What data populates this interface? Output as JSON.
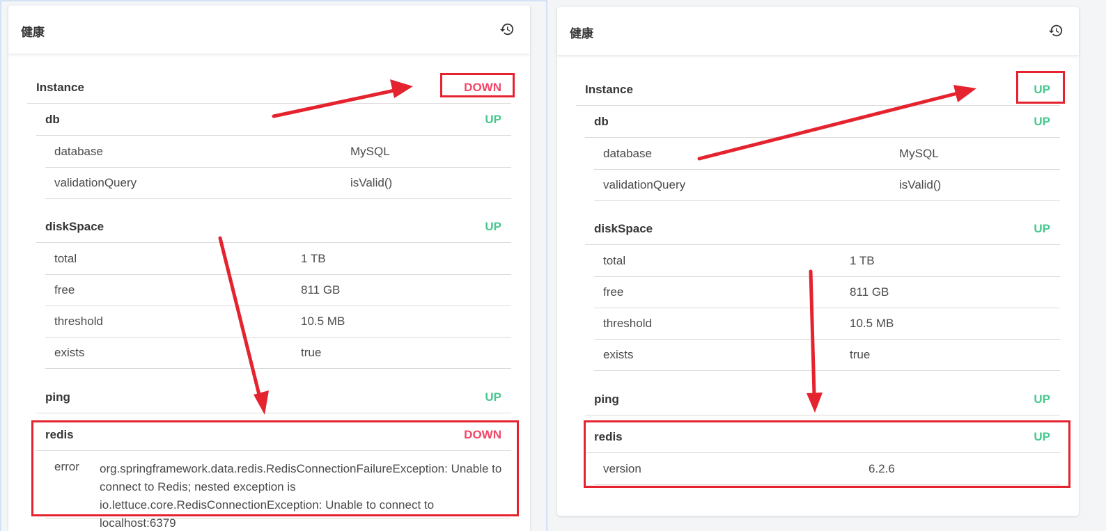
{
  "left": {
    "title": "健康",
    "instance": {
      "label": "Instance",
      "status": "DOWN"
    },
    "db": {
      "label": "db",
      "status": "UP",
      "details": [
        {
          "key": "database",
          "value": "MySQL"
        },
        {
          "key": "validationQuery",
          "value": "isValid()"
        }
      ]
    },
    "diskSpace": {
      "label": "diskSpace",
      "status": "UP",
      "details": [
        {
          "key": "total",
          "value": "1 TB"
        },
        {
          "key": "free",
          "value": "811 GB"
        },
        {
          "key": "threshold",
          "value": "10.5 MB"
        },
        {
          "key": "exists",
          "value": "true"
        }
      ]
    },
    "ping": {
      "label": "ping",
      "status": "UP"
    },
    "redis": {
      "label": "redis",
      "status": "DOWN",
      "error_key": "error",
      "error_value": "org.springframework.data.redis.RedisConnectionFailureException: Unable to connect to Redis; nested exception is io.lettuce.core.RedisConnectionException: Unable to connect to localhost:6379"
    }
  },
  "right": {
    "title": "健康",
    "instance": {
      "label": "Instance",
      "status": "UP"
    },
    "db": {
      "label": "db",
      "status": "UP",
      "details": [
        {
          "key": "database",
          "value": "MySQL"
        },
        {
          "key": "validationQuery",
          "value": "isValid()"
        }
      ]
    },
    "diskSpace": {
      "label": "diskSpace",
      "status": "UP",
      "details": [
        {
          "key": "total",
          "value": "1 TB"
        },
        {
          "key": "free",
          "value": "811 GB"
        },
        {
          "key": "threshold",
          "value": "10.5 MB"
        },
        {
          "key": "exists",
          "value": "true"
        }
      ]
    },
    "ping": {
      "label": "ping",
      "status": "UP"
    },
    "redis": {
      "label": "redis",
      "status": "UP",
      "details": [
        {
          "key": "version",
          "value": "6.2.6"
        }
      ]
    }
  },
  "colors": {
    "up": "#48c78e",
    "down": "#f14668",
    "annotation": "#e5232f"
  },
  "icons": [
    "history-icon",
    "annotation-arrow"
  ]
}
